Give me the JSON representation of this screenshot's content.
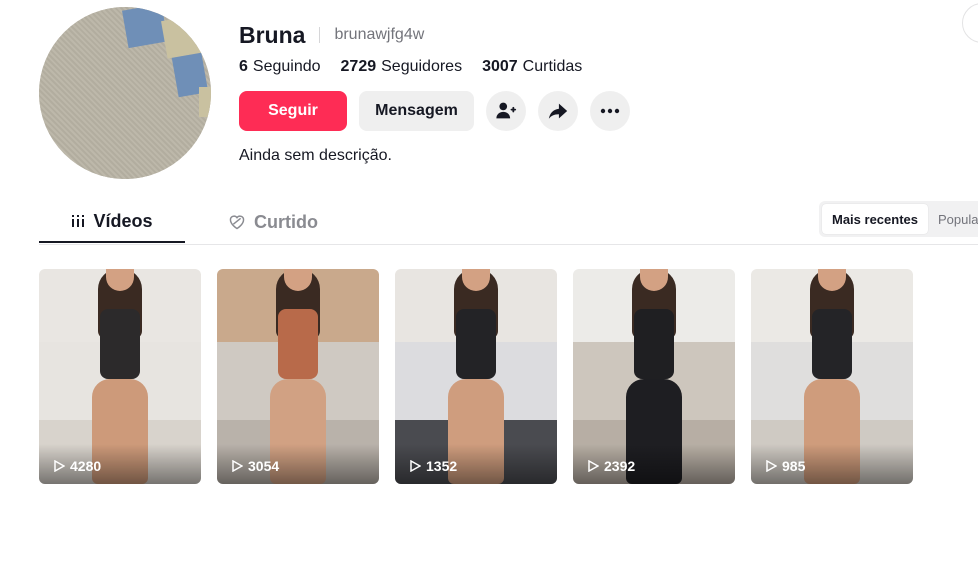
{
  "profile": {
    "display_name": "Bruna",
    "username": "brunawjfg4w",
    "bio": "Ainda sem descrição.",
    "stats": {
      "following_count": "6",
      "following_label": "Seguindo",
      "followers_count": "2729",
      "followers_label": "Seguidores",
      "likes_count": "3007",
      "likes_label": "Curtidas"
    }
  },
  "actions": {
    "follow_label": "Seguir",
    "message_label": "Mensagem",
    "follow_color": "#fe2c55"
  },
  "tabs": {
    "videos_label": "Vídeos",
    "liked_label": "Curtido"
  },
  "sort": {
    "active_label": "Mais recentes",
    "inactive_label": "Popula"
  },
  "videos": [
    {
      "views": "4280"
    },
    {
      "views": "3054"
    },
    {
      "views": "1352"
    },
    {
      "views": "2392"
    },
    {
      "views": "985"
    }
  ]
}
